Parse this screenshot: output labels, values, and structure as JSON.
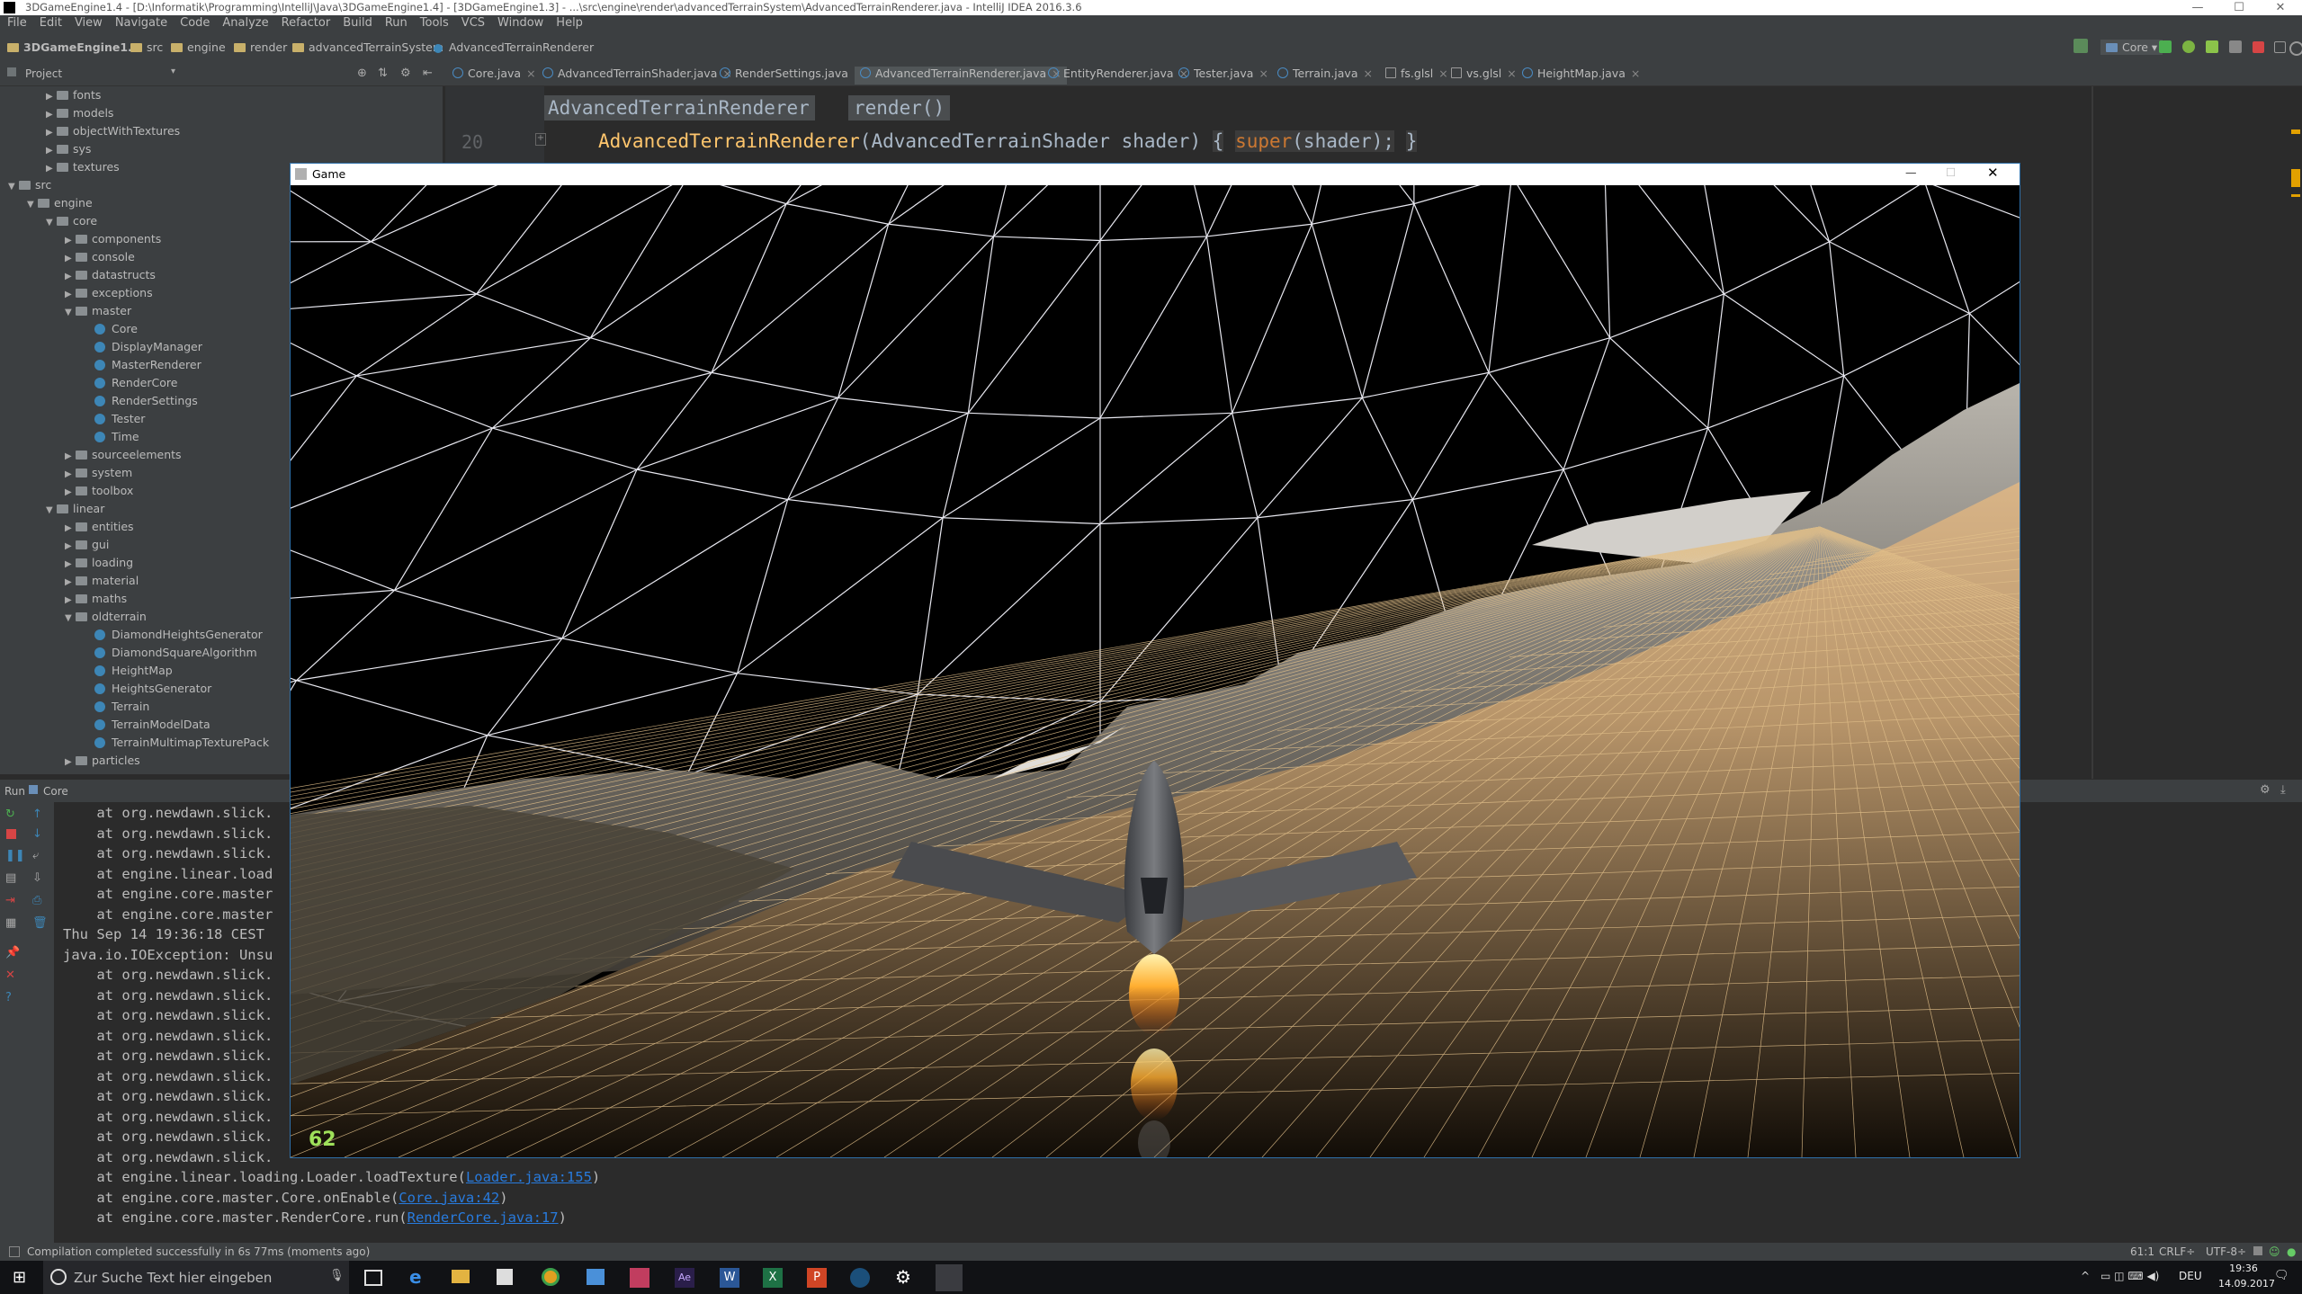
{
  "ide": {
    "title": "3DGameEngine1.4 - [D:\\Informatik\\Programming\\IntelliJ\\Java\\3DGameEngine1.4] - [3DGameEngine1.3] - ...\\src\\engine\\render\\advancedTerrainSystem\\AdvancedTerrainRenderer.java - IntelliJ IDEA 2016.3.6",
    "menu": [
      "File",
      "Edit",
      "View",
      "Navigate",
      "Code",
      "Analyze",
      "Refactor",
      "Build",
      "Run",
      "Tools",
      "VCS",
      "Window",
      "Help"
    ],
    "breadcrumbs": [
      "3DGameEngine1.4",
      "src",
      "engine",
      "render",
      "advancedTerrainSystem",
      "AdvancedTerrainRenderer"
    ],
    "run_config": "Core"
  },
  "project_panel": {
    "label": "Project",
    "items": [
      {
        "label": "fonts",
        "indent": 3,
        "type": "folder",
        "arrow": "▶"
      },
      {
        "label": "models",
        "indent": 3,
        "type": "folder",
        "arrow": "▶"
      },
      {
        "label": "objectWithTextures",
        "indent": 3,
        "type": "folder",
        "arrow": "▶"
      },
      {
        "label": "sys",
        "indent": 3,
        "type": "folder",
        "arrow": "▶"
      },
      {
        "label": "textures",
        "indent": 3,
        "type": "folder",
        "arrow": "▶"
      },
      {
        "label": "src",
        "indent": 1,
        "type": "folder",
        "arrow": "▼"
      },
      {
        "label": "engine",
        "indent": 2,
        "type": "folder",
        "arrow": "▼"
      },
      {
        "label": "core",
        "indent": 3,
        "type": "folder",
        "arrow": "▼"
      },
      {
        "label": "components",
        "indent": 4,
        "type": "folder",
        "arrow": "▶"
      },
      {
        "label": "console",
        "indent": 4,
        "type": "folder",
        "arrow": "▶"
      },
      {
        "label": "datastructs",
        "indent": 4,
        "type": "folder",
        "arrow": "▶"
      },
      {
        "label": "exceptions",
        "indent": 4,
        "type": "folder",
        "arrow": "▶"
      },
      {
        "label": "master",
        "indent": 4,
        "type": "folder",
        "arrow": "▼"
      },
      {
        "label": "Core",
        "indent": 5,
        "type": "class",
        "arrow": ""
      },
      {
        "label": "DisplayManager",
        "indent": 5,
        "type": "class",
        "arrow": ""
      },
      {
        "label": "MasterRenderer",
        "indent": 5,
        "type": "class",
        "arrow": ""
      },
      {
        "label": "RenderCore",
        "indent": 5,
        "type": "class",
        "arrow": ""
      },
      {
        "label": "RenderSettings",
        "indent": 5,
        "type": "class",
        "arrow": ""
      },
      {
        "label": "Tester",
        "indent": 5,
        "type": "class",
        "arrow": ""
      },
      {
        "label": "Time",
        "indent": 5,
        "type": "class",
        "arrow": ""
      },
      {
        "label": "sourceelements",
        "indent": 4,
        "type": "folder",
        "arrow": "▶"
      },
      {
        "label": "system",
        "indent": 4,
        "type": "folder",
        "arrow": "▶"
      },
      {
        "label": "toolbox",
        "indent": 4,
        "type": "folder",
        "arrow": "▶"
      },
      {
        "label": "linear",
        "indent": 3,
        "type": "folder",
        "arrow": "▼"
      },
      {
        "label": "entities",
        "indent": 4,
        "type": "folder",
        "arrow": "▶"
      },
      {
        "label": "gui",
        "indent": 4,
        "type": "folder",
        "arrow": "▶"
      },
      {
        "label": "loading",
        "indent": 4,
        "type": "folder",
        "arrow": "▶"
      },
      {
        "label": "material",
        "indent": 4,
        "type": "folder",
        "arrow": "▶"
      },
      {
        "label": "maths",
        "indent": 4,
        "type": "folder",
        "arrow": "▶"
      },
      {
        "label": "oldterrain",
        "indent": 4,
        "type": "folder",
        "arrow": "▼"
      },
      {
        "label": "DiamondHeightsGenerator",
        "indent": 5,
        "type": "class",
        "arrow": ""
      },
      {
        "label": "DiamondSquareAlgorithm",
        "indent": 5,
        "type": "class",
        "arrow": ""
      },
      {
        "label": "HeightMap",
        "indent": 5,
        "type": "class",
        "arrow": ""
      },
      {
        "label": "HeightsGenerator",
        "indent": 5,
        "type": "class",
        "arrow": ""
      },
      {
        "label": "Terrain",
        "indent": 5,
        "type": "class",
        "arrow": ""
      },
      {
        "label": "TerrainModelData",
        "indent": 5,
        "type": "class",
        "arrow": ""
      },
      {
        "label": "TerrainMultimapTexturePack",
        "indent": 5,
        "type": "class",
        "arrow": ""
      },
      {
        "label": "particles",
        "indent": 4,
        "type": "folder",
        "arrow": "▶"
      }
    ]
  },
  "tabs": [
    {
      "label": "Core.java",
      "active": false
    },
    {
      "label": "AdvancedTerrainShader.java",
      "active": false
    },
    {
      "label": "RenderSettings.java",
      "active": false
    },
    {
      "label": "AdvancedTerrainRenderer.java",
      "active": true
    },
    {
      "label": "EntityRenderer.java",
      "active": false
    },
    {
      "label": "Tester.java",
      "active": false
    },
    {
      "label": "Terrain.java",
      "active": false
    },
    {
      "label": "fs.glsl",
      "active": false
    },
    {
      "label": "vs.glsl",
      "active": false
    },
    {
      "label": "HeightMap.java",
      "active": false
    }
  ],
  "editor": {
    "breadcrumb_class": "AdvancedTerrainRenderer",
    "breadcrumb_method": "render()",
    "line_number": "20",
    "code_ctor": "AdvancedTerrainRenderer",
    "code_params": "(AdvancedTerrainShader shader)",
    "code_open": "{",
    "code_super": "super",
    "code_rest": "(shader);",
    "code_close": "}"
  },
  "run_panel": {
    "label": "Run",
    "config": "Core",
    "lines": [
      {
        "text": "    at org.newdawn.slick.",
        "link": "",
        "tail": ""
      },
      {
        "text": "    at org.newdawn.slick.",
        "link": "",
        "tail": ""
      },
      {
        "text": "    at org.newdawn.slick.",
        "link": "",
        "tail": ""
      },
      {
        "text": "    at engine.linear.load",
        "link": "",
        "tail": ""
      },
      {
        "text": "    at engine.core.master",
        "link": "",
        "tail": ""
      },
      {
        "text": "    at engine.core.master",
        "link": "",
        "tail": ""
      },
      {
        "text": "Thu Sep 14 19:36:18 CEST",
        "link": "",
        "tail": ""
      },
      {
        "text": "java.io.IOException: Unsu",
        "link": "",
        "tail": ""
      },
      {
        "text": "    at org.newdawn.slick.",
        "link": "",
        "tail": ""
      },
      {
        "text": "    at org.newdawn.slick.",
        "link": "",
        "tail": ""
      },
      {
        "text": "    at org.newdawn.slick.",
        "link": "",
        "tail": ""
      },
      {
        "text": "    at org.newdawn.slick.",
        "link": "",
        "tail": ""
      },
      {
        "text": "    at org.newdawn.slick.",
        "link": "",
        "tail": ""
      },
      {
        "text": "    at org.newdawn.slick.",
        "link": "",
        "tail": ""
      },
      {
        "text": "    at org.newdawn.slick.",
        "link": "",
        "tail": ""
      },
      {
        "text": "    at org.newdawn.slick.",
        "link": "",
        "tail": ""
      },
      {
        "text": "    at org.newdawn.slick.",
        "link": "",
        "tail": ""
      },
      {
        "text": "    at org.newdawn.slick.",
        "link": "",
        "tail": ""
      },
      {
        "text": "    at engine.linear.loading.Loader.loadTexture(",
        "link": "Loader.java:155",
        "tail": ")"
      },
      {
        "text": "    at engine.core.master.Core.onEnable(",
        "link": "Core.java:42",
        "tail": ")"
      },
      {
        "text": "    at engine.core.master.RenderCore.run(",
        "link": "RenderCore.java:17",
        "tail": ")"
      }
    ]
  },
  "status_bar": {
    "message": "Compilation completed successfully in 6s 77ms (moments ago)",
    "position": "61:1",
    "line_sep": "CRLF÷",
    "encoding": "UTF-8÷"
  },
  "game_window": {
    "title": "Game",
    "fps": "62"
  },
  "taskbar": {
    "search_placeholder": "Zur Suche Text hier eingeben",
    "lang": "DEU",
    "time": "19:36",
    "date": "14.09.2017"
  },
  "colors": {
    "ide_bg": "#2b2b2b",
    "panel_bg": "#3c3f41",
    "sky_grid": "#e8e8f0",
    "terrain_grid": "#e2c08a",
    "flame": "#ff9a1a"
  }
}
